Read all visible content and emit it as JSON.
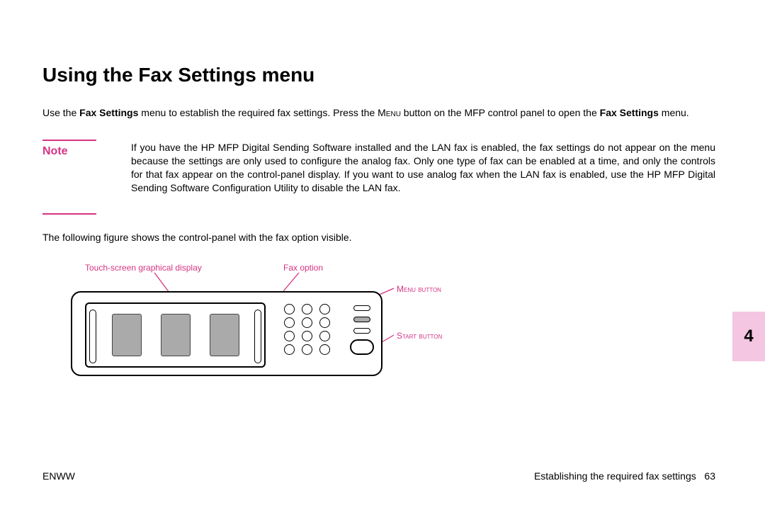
{
  "heading": "Using the Fax Settings menu",
  "intro": {
    "t1": "Use the ",
    "b1": "Fax Settings",
    "t2": " menu to establish the required fax settings. Press the ",
    "sc1": "Menu",
    "t3": " button on the MFP control panel to open the ",
    "b2": "Fax Settings",
    "t4": " menu."
  },
  "note": {
    "label": "Note",
    "body": "If you have the HP MFP Digital Sending Software installed and the LAN fax is enabled, the fax settings do not appear on the menu because the settings are only used to configure the analog fax. Only one type of fax can be enabled at a time, and only the controls for that fax appear on the control-panel display. If you want to use analog fax when the LAN fax is enabled, use the HP MFP Digital Sending Software Configuration Utility to disable the LAN fax."
  },
  "para": "The following figure shows the control-panel with the fax option visible.",
  "callouts": {
    "touch": "Touch-screen graphical display",
    "fax": "Fax option",
    "menu": "Menu button",
    "start": "Start button"
  },
  "tab": "4",
  "footer": {
    "left": "ENWW",
    "right_text": "Establishing the required fax settings",
    "right_page": "63"
  }
}
